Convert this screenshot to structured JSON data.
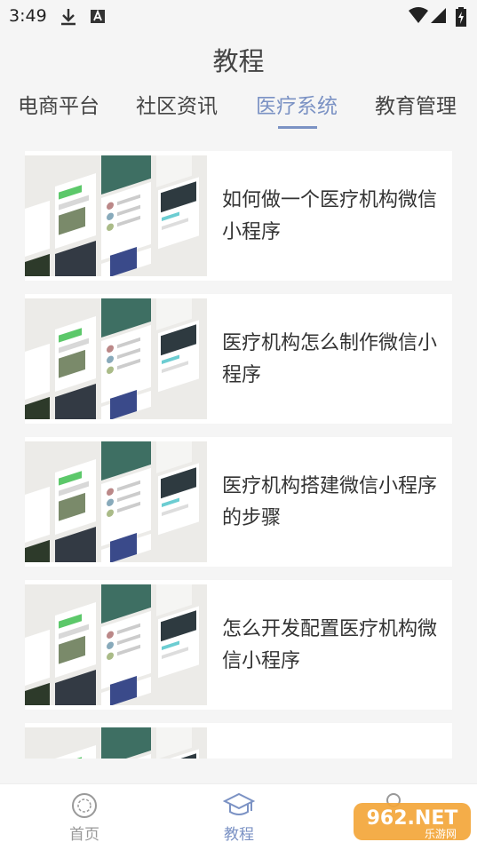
{
  "status_bar": {
    "time": "3:49"
  },
  "header": {
    "title": "教程"
  },
  "tabs": [
    {
      "label": "电商平台"
    },
    {
      "label": "社区资讯"
    },
    {
      "label": "医疗系统"
    },
    {
      "label": "教育管理"
    }
  ],
  "articles": [
    {
      "title": "如何做一个医疗机构微信小程序"
    },
    {
      "title": "医疗机构怎么制作微信小程序"
    },
    {
      "title": "医疗机构搭建微信小程序的步骤"
    },
    {
      "title": "怎么开发配置医疗机构微信小程序"
    }
  ],
  "bottom_nav": [
    {
      "label": "首页",
      "icon": "home-icon"
    },
    {
      "label": "教程",
      "icon": "mortarboard-icon"
    }
  ],
  "watermark": {
    "text": "962.NET",
    "subtext": "乐游网"
  },
  "colors": {
    "accent": "#7b92c4",
    "background": "#f5f5f5"
  }
}
